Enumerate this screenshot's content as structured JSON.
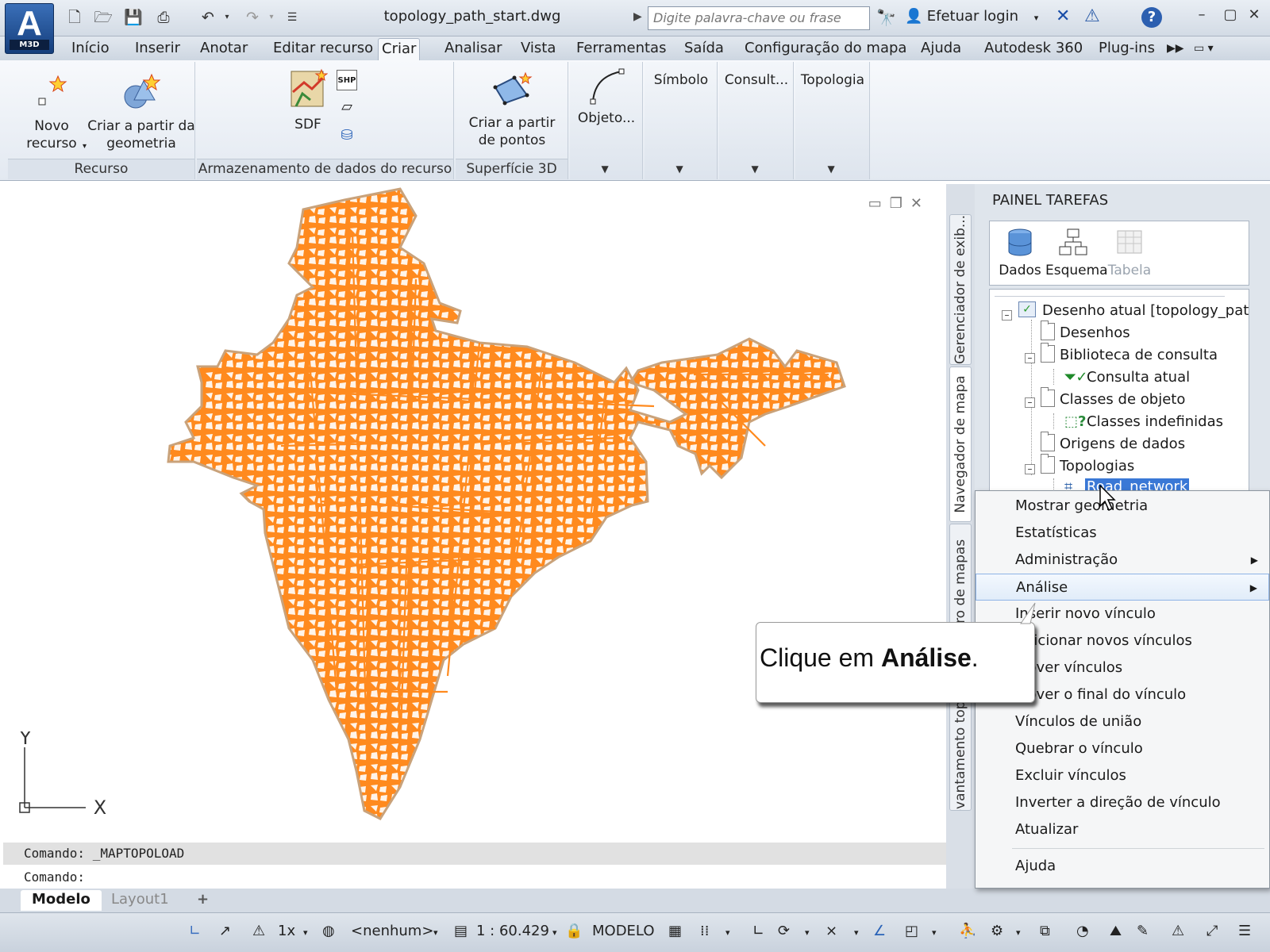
{
  "app": {
    "logo_tag": "M3D",
    "document_title": "topology_path_start.dwg",
    "search_placeholder": "Digite palavra-chave ou frase",
    "login_label": "Efetuar login"
  },
  "ribbon_tabs": [
    "Início",
    "Inserir",
    "Anotar",
    "Editar recurso",
    "Criar",
    "Analisar",
    "Vista",
    "Ferramentas",
    "Saída",
    "Configuração do mapa",
    "Ajuda",
    "Autodesk 360",
    "Plug-ins"
  ],
  "active_ribbon_tab": "Criar",
  "ribbon": {
    "recurso": {
      "label": "Recurso",
      "novo_recurso": "Novo recurso",
      "criar_geometria": "Criar a partir da geometria"
    },
    "armazenamento": {
      "label": "Armazenamento de dados do recurso",
      "sdf": "SDF",
      "shp_tag": "SHP"
    },
    "superficie": {
      "label": "Superfície 3D",
      "criar_pontos": "Criar a partir de pontos"
    },
    "objeto": "Objeto...",
    "simbolo": "Símbolo",
    "consult": "Consult...",
    "topologia": "Topologia"
  },
  "command_line": {
    "history": "Comando:  _MAPTOPOLOAD",
    "prompt": "Comando:"
  },
  "ucs": {
    "y_label": "Y",
    "x_label": "X"
  },
  "layout_tabs": [
    "Modelo",
    "Layout1"
  ],
  "status_bar": {
    "scale_factor": "1x",
    "coordinate_system": "<nenhum>",
    "map_scale": "1 : 60.429",
    "space": "MODELO"
  },
  "side_tabs": [
    "Gerenciador de exib...",
    "Navegador de mapa",
    "Livro de mapas",
    "Levantamento topográfico"
  ],
  "task_pane": {
    "title": "PAINEL TAREFAS",
    "tools": [
      "Dados",
      "Esquema",
      "Tabela"
    ],
    "tree": {
      "root": "Desenho atual [topology_path_",
      "desenhos": "Desenhos",
      "biblioteca": "Biblioteca de consulta",
      "consulta_atual": "Consulta atual",
      "classes_objeto": "Classes de objeto",
      "classes_indefinidas": "Classes indefinidas",
      "origens": "Origens de dados",
      "topologias": "Topologias",
      "road_network": "Road_network"
    }
  },
  "context_menu": {
    "items": [
      "Mostrar geometria",
      "Estatísticas",
      "Administração",
      "Análise",
      "Inserir novo vínculo",
      "Adicionar novos vínculos",
      "Mover vínculos",
      "Mover o final do vínculo",
      "Vínculos de união",
      "Quebrar o vínculo",
      "Excluir vínculos",
      "Inverter a direção de vínculo",
      "Atualizar",
      "Ajuda"
    ],
    "highlighted": "Análise"
  },
  "callout": {
    "text_prefix": "Clique em",
    "text_bold": "Análise",
    "text_suffix": "."
  },
  "colors": {
    "map_road_orange": "#ff8a1e",
    "map_outline": "#c9a27a",
    "menu_highlight_border": "#8eb3e6",
    "selection_blue": "#3a78d6"
  }
}
